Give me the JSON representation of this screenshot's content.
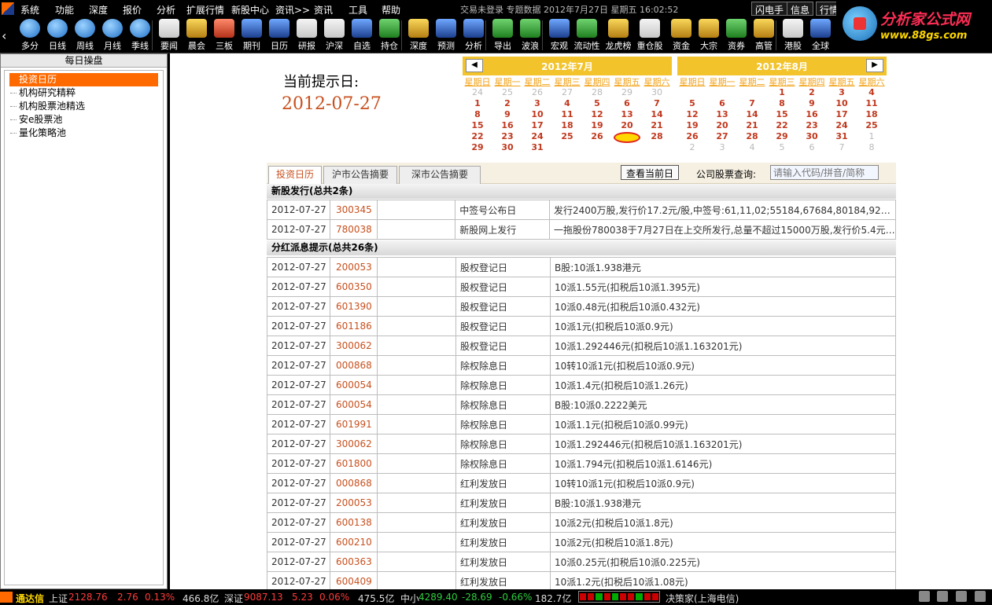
{
  "menubar": {
    "items": [
      "系统",
      "功能",
      "深度",
      "报价",
      "分析",
      "扩展行情",
      "新股中心",
      "资讯>>",
      "资讯",
      "工具",
      "帮助"
    ],
    "status": "交易未登录   专题数据  2012年7月27日  星期五  16:02:52",
    "right_buttons": [
      "闪电手",
      "信息",
      "行情"
    ]
  },
  "toolbar": {
    "buttons": [
      {
        "label": "多分",
        "icon": "multi-period-icon"
      },
      {
        "label": "日线",
        "icon": "daily-line-icon"
      },
      {
        "label": "周线",
        "icon": "weekly-line-icon"
      },
      {
        "label": "月线",
        "icon": "monthly-line-icon"
      },
      {
        "label": "季线",
        "icon": "quarterly-line-icon"
      },
      {
        "label": "要闻",
        "icon": "news-icon"
      },
      {
        "label": "晨会",
        "icon": "morning-meeting-icon"
      },
      {
        "label": "三板",
        "icon": "third-board-icon"
      },
      {
        "label": "期刊",
        "icon": "journal-icon"
      },
      {
        "label": "日历",
        "icon": "calendar-icon"
      },
      {
        "label": "研报",
        "icon": "research-report-icon"
      },
      {
        "label": "沪深",
        "icon": "sh-sz-icon"
      },
      {
        "label": "自选",
        "icon": "watchlist-icon"
      },
      {
        "label": "持仓",
        "icon": "holdings-icon"
      },
      {
        "label": "深度",
        "icon": "depth-icon"
      },
      {
        "label": "预测",
        "icon": "forecast-icon"
      },
      {
        "label": "分析",
        "icon": "analysis-icon"
      },
      {
        "label": "导出",
        "icon": "export-icon"
      },
      {
        "label": "波浪",
        "icon": "wave-icon"
      },
      {
        "label": "宏观",
        "icon": "macro-icon"
      },
      {
        "label": "流动性",
        "icon": "liquidity-icon"
      },
      {
        "label": "龙虎榜",
        "icon": "dragon-tiger-icon"
      },
      {
        "label": "重仓股",
        "icon": "heavy-holdings-icon"
      },
      {
        "label": "资金",
        "icon": "funds-icon"
      },
      {
        "label": "大宗",
        "icon": "block-trade-icon"
      },
      {
        "label": "资券",
        "icon": "margin-icon"
      },
      {
        "label": "高管",
        "icon": "executives-icon"
      },
      {
        "label": "港股",
        "icon": "hk-stocks-icon"
      },
      {
        "label": "全球",
        "icon": "global-icon"
      }
    ],
    "brand_name": "分析家公式网",
    "brand_url": "www.88gs.com"
  },
  "left_panel": {
    "title": "每日操盘",
    "items": [
      "投资日历",
      "机构研究精粹",
      "机构股票池精选",
      "安e股票池",
      "量化策略池"
    ]
  },
  "main": {
    "current_label": "当前提示日:",
    "current_date": "2012-07-27",
    "calendars": [
      {
        "title": "2012年7月",
        "weekdays": [
          "星期日",
          "星期一",
          "星期二",
          "星期三",
          "星期四",
          "星期五",
          "星期六"
        ],
        "days": [
          [
            "24",
            "o"
          ],
          [
            "25",
            "o"
          ],
          [
            "26",
            "o"
          ],
          [
            "27",
            "o"
          ],
          [
            "28",
            "o"
          ],
          [
            "29",
            "o"
          ],
          [
            "30",
            "o"
          ],
          [
            "1",
            ""
          ],
          [
            "2",
            ""
          ],
          [
            "3",
            ""
          ],
          [
            "4",
            ""
          ],
          [
            "5",
            ""
          ],
          [
            "6",
            ""
          ],
          [
            "7",
            ""
          ],
          [
            "8",
            ""
          ],
          [
            "9",
            ""
          ],
          [
            "10",
            ""
          ],
          [
            "11",
            ""
          ],
          [
            "12",
            ""
          ],
          [
            "13",
            ""
          ],
          [
            "14",
            ""
          ],
          [
            "15",
            ""
          ],
          [
            "16",
            ""
          ],
          [
            "17",
            ""
          ],
          [
            "18",
            ""
          ],
          [
            "19",
            ""
          ],
          [
            "20",
            ""
          ],
          [
            "21",
            ""
          ],
          [
            "22",
            ""
          ],
          [
            "23",
            ""
          ],
          [
            "24",
            ""
          ],
          [
            "25",
            ""
          ],
          [
            "26",
            ""
          ],
          [
            "27",
            "today"
          ],
          [
            "28",
            ""
          ],
          [
            "29",
            ""
          ],
          [
            "30",
            ""
          ],
          [
            "31",
            ""
          ]
        ]
      },
      {
        "title": "2012年8月",
        "weekdays": [
          "星期日",
          "星期一",
          "星期二",
          "星期三",
          "星期四",
          "星期五",
          "星期六"
        ],
        "days": [
          [
            "",
            "o"
          ],
          [
            "",
            "o"
          ],
          [
            "",
            "o"
          ],
          [
            "1",
            ""
          ],
          [
            "2",
            ""
          ],
          [
            "3",
            ""
          ],
          [
            "4",
            ""
          ],
          [
            "5",
            ""
          ],
          [
            "6",
            ""
          ],
          [
            "7",
            ""
          ],
          [
            "8",
            ""
          ],
          [
            "9",
            ""
          ],
          [
            "10",
            ""
          ],
          [
            "11",
            ""
          ],
          [
            "12",
            ""
          ],
          [
            "13",
            ""
          ],
          [
            "14",
            ""
          ],
          [
            "15",
            ""
          ],
          [
            "16",
            ""
          ],
          [
            "17",
            ""
          ],
          [
            "18",
            ""
          ],
          [
            "19",
            ""
          ],
          [
            "20",
            ""
          ],
          [
            "21",
            ""
          ],
          [
            "22",
            ""
          ],
          [
            "23",
            ""
          ],
          [
            "24",
            ""
          ],
          [
            "25",
            ""
          ],
          [
            "26",
            ""
          ],
          [
            "27",
            ""
          ],
          [
            "28",
            ""
          ],
          [
            "29",
            ""
          ],
          [
            "30",
            ""
          ],
          [
            "31",
            ""
          ],
          [
            "1",
            "o"
          ],
          [
            "2",
            "o"
          ],
          [
            "3",
            "o"
          ],
          [
            "4",
            "o"
          ],
          [
            "5",
            "o"
          ],
          [
            "6",
            "o"
          ],
          [
            "7",
            "o"
          ],
          [
            "8",
            "o"
          ]
        ]
      }
    ],
    "tabs": [
      "投资日历",
      "沪市公告摘要",
      "深市公告摘要"
    ],
    "view_today_button": "查看当前日",
    "query_label": "公司股票查询:",
    "query_placeholder": "请输入代码/拼音/简称",
    "sections": [
      {
        "title": "新股发行(总共2条)",
        "rows": [
          {
            "date": "2012-07-27",
            "code": "300345",
            "name": "",
            "type": "中签号公布日",
            "desc": "发行2400万股,发行价17.2元/股,中签号:61,11,02;55184,67684,80184,92684,..."
          },
          {
            "date": "2012-07-27",
            "code": "780038",
            "name": "",
            "type": "新股网上发行",
            "desc": "一拖股份780038于7月27日在上交所发行,总量不超过15000万股,发行价5.4元,..."
          }
        ]
      },
      {
        "title": "分红派息提示(总共26条)",
        "rows": [
          {
            "date": "2012-07-27",
            "code": "200053",
            "name": "",
            "type": "股权登记日",
            "desc": "B股:10派1.938港元"
          },
          {
            "date": "2012-07-27",
            "code": "600350",
            "name": "",
            "type": "股权登记日",
            "desc": "10派1.55元(扣税后10派1.395元)"
          },
          {
            "date": "2012-07-27",
            "code": "601390",
            "name": "",
            "type": "股权登记日",
            "desc": "10派0.48元(扣税后10派0.432元)"
          },
          {
            "date": "2012-07-27",
            "code": "601186",
            "name": "",
            "type": "股权登记日",
            "desc": "10派1元(扣税后10派0.9元)"
          },
          {
            "date": "2012-07-27",
            "code": "300062",
            "name": "",
            "type": "股权登记日",
            "desc": "10派1.292446元(扣税后10派1.163201元)"
          },
          {
            "date": "2012-07-27",
            "code": "000868",
            "name": "",
            "type": "除权除息日",
            "desc": "10转10派1元(扣税后10派0.9元)"
          },
          {
            "date": "2012-07-27",
            "code": "600054",
            "name": "",
            "type": "除权除息日",
            "desc": "10派1.4元(扣税后10派1.26元)"
          },
          {
            "date": "2012-07-27",
            "code": "600054",
            "name": "",
            "type": "除权除息日",
            "desc": "B股:10派0.2222美元"
          },
          {
            "date": "2012-07-27",
            "code": "601991",
            "name": "",
            "type": "除权除息日",
            "desc": "10派1.1元(扣税后10派0.99元)"
          },
          {
            "date": "2012-07-27",
            "code": "300062",
            "name": "",
            "type": "除权除息日",
            "desc": "10派1.292446元(扣税后10派1.163201元)"
          },
          {
            "date": "2012-07-27",
            "code": "601800",
            "name": "",
            "type": "除权除息日",
            "desc": "10派1.794元(扣税后10派1.6146元)"
          },
          {
            "date": "2012-07-27",
            "code": "000868",
            "name": "",
            "type": "红利发放日",
            "desc": "10转10派1元(扣税后10派0.9元)"
          },
          {
            "date": "2012-07-27",
            "code": "200053",
            "name": "",
            "type": "红利发放日",
            "desc": "B股:10派1.938港元"
          },
          {
            "date": "2012-07-27",
            "code": "600138",
            "name": "",
            "type": "红利发放日",
            "desc": "10派2元(扣税后10派1.8元)"
          },
          {
            "date": "2012-07-27",
            "code": "600210",
            "name": "",
            "type": "红利发放日",
            "desc": "10派2元(扣税后10派1.8元)"
          },
          {
            "date": "2012-07-27",
            "code": "600363",
            "name": "",
            "type": "红利发放日",
            "desc": "10派0.25元(扣税后10派0.225元)"
          },
          {
            "date": "2012-07-27",
            "code": "600409",
            "name": "",
            "type": "红利发放日",
            "desc": "10派1.2元(扣税后10派1.08元)"
          }
        ]
      }
    ]
  },
  "statusbar": {
    "app_name": "通达信",
    "sh": {
      "label": "上证",
      "value": "2128.76",
      "change": "2.76",
      "pct": "0.13%",
      "amount": "466.8亿"
    },
    "sz": {
      "label": "深证",
      "value": "9087.13",
      "change": "5.23",
      "pct": "0.06%",
      "amount": "475.5亿"
    },
    "sme": {
      "label": "中小",
      "value": "4289.40",
      "change": "-28.69",
      "pct": "-0.66%",
      "amount": "182.7亿"
    },
    "server": "决策家(上海电信)"
  },
  "colors": {
    "accent": "#ff6a00",
    "up": "#ff3b3b",
    "down": "#2ecc40",
    "calendar_header": "#f2c32a",
    "code": "#c8501e"
  }
}
